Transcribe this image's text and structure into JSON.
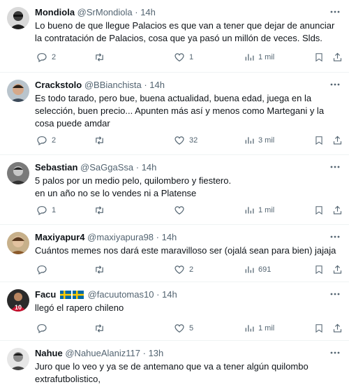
{
  "colors": {
    "text": "#0f1419",
    "muted": "#536471",
    "border": "#eff3f4"
  },
  "icons": {
    "reply": "reply-icon",
    "retweet": "retweet-icon",
    "like": "heart-icon",
    "views": "views-icon",
    "bookmark": "bookmark-icon",
    "share": "share-icon",
    "more": "more-icon"
  },
  "tweets": [
    {
      "name": "Mondiola",
      "handle": "@SrMondiola",
      "time": "· 14h",
      "text": "Lo bueno de que llegue Palacios es que van a tener que dejar de anunciar la contratación de Palacios, cosa que ya pasó un millón de veces. Slds.",
      "replies": "2",
      "retweets": "",
      "likes": "1",
      "views": "1 mil"
    },
    {
      "name": "Crackstolo",
      "handle": "@BBianchista",
      "time": "· 14h",
      "text": "Es todo tarado, pero bue, buena actualidad, buena edad, juega en la selección, buen precio... Apunten más así y menos como Martegani y la cosa puede amdar",
      "replies": "2",
      "retweets": "",
      "likes": "32",
      "views": "3 mil"
    },
    {
      "name": "Sebastian",
      "handle": "@SaGgaSsa",
      "time": "· 14h",
      "text": "5 palos por un medio pelo, quilombero y fiestero.\nen un año no se lo vendes ni a Platense",
      "replies": "1",
      "retweets": "",
      "likes": "",
      "views": "1 mil"
    },
    {
      "name": "Maxiyapur4",
      "handle": "@maxiyapura98",
      "time": "· 14h",
      "text": "Cuántos memes nos dará este maravilloso ser (ojalá sean para bien) jajaja",
      "replies": "",
      "retweets": "",
      "likes": "2",
      "views": "691"
    },
    {
      "name": "Facu",
      "handle": "@facuutomas10",
      "time": "· 14h",
      "text": "llegó el rapero chileno",
      "replies": "",
      "retweets": "",
      "likes": "5",
      "views": "1 mil"
    },
    {
      "name": "Nahue",
      "handle": "@NahueAlaniz117",
      "time": "· 13h",
      "text": "Juro que lo veo y ya se de antemano que va a  tener algún quilombo extrafutbolistico,",
      "replies": "",
      "retweets": "",
      "likes": "",
      "views": ""
    }
  ]
}
